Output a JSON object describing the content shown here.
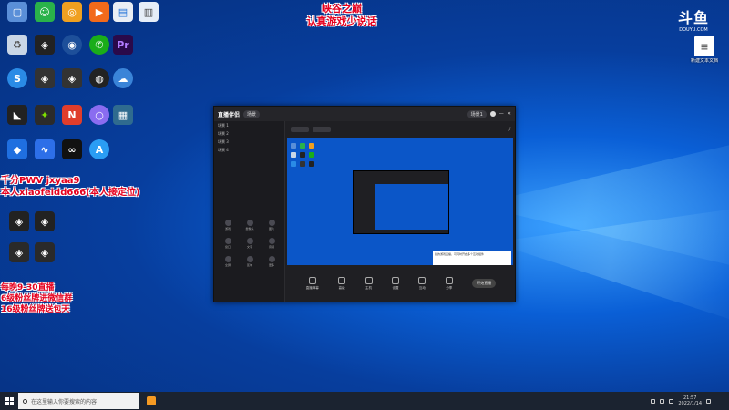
{
  "overlay": {
    "title_line1": "峡谷之巅",
    "title_line2": "认真游戏少说话",
    "promo_line1": "千分PWV jxyaa9",
    "promo_line2": "本人xiaofeidd666(本人接定位)",
    "promo_line3": "每晚9-30直播",
    "promo_line4": "6级粉丝牌进微信群",
    "promo_line5": "16级粉丝牌送包天"
  },
  "watermark": {
    "logo": "斗鱼",
    "url": "DOUYU.COM"
  },
  "desktop_right_icon": {
    "label": "新建文本文档"
  },
  "app_window": {
    "brand": "直播伴侣",
    "tab_label": "场景",
    "header_pill": "场景1",
    "scene_rows": [
      "场景 1",
      "场景 2",
      "场景 3",
      "场景 4"
    ],
    "tool_grid": [
      "游戏",
      "摄像头",
      "图片",
      "窗口",
      "文字",
      "音频",
      "全屏",
      "区域",
      "更多"
    ],
    "toolbar": [
      "直播弹幕",
      "高级",
      "主机",
      "设置",
      "互动",
      "分享"
    ],
    "live_button": "开始直播",
    "note": "我的游戏直播，可同时开启多个互动组件"
  },
  "taskbar": {
    "search_placeholder": "在这里输入你要搜索的内容",
    "time": "21:57",
    "date": "2022/1/14"
  },
  "colors": {
    "accent_red": "#e6001e",
    "desktop_blue": "#0a5fd6",
    "taskbar": "#1b2330"
  }
}
